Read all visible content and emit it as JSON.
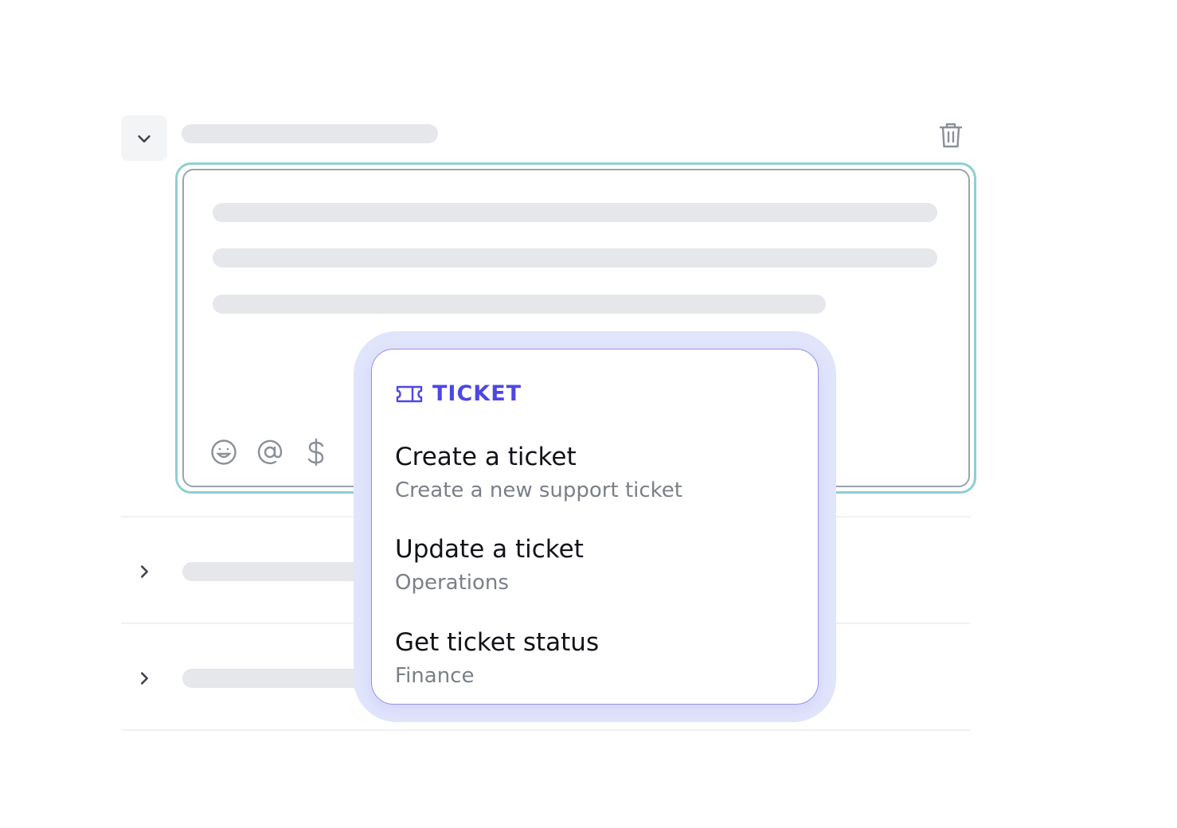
{
  "colors": {
    "accent": "#4f46e5",
    "focus_ring": "#8ecfd2",
    "skeleton": "#e5e7eb",
    "halo": "#e1e5fb",
    "icon_gray": "#9ca3af"
  },
  "icons": {
    "collapse": "chevron-down-icon",
    "delete": "trash-icon",
    "toolbar": [
      "emoji-icon",
      "at-icon",
      "dollar-icon"
    ],
    "rows": "chevron-right-icon",
    "menu_header": "ticket-icon"
  },
  "menu": {
    "header": "TICKET",
    "items": [
      {
        "title": "Create a ticket",
        "subtitle": "Create a new support ticket"
      },
      {
        "title": "Update a ticket",
        "subtitle": "Operations"
      },
      {
        "title": "Get ticket status",
        "subtitle": "Finance"
      }
    ]
  }
}
